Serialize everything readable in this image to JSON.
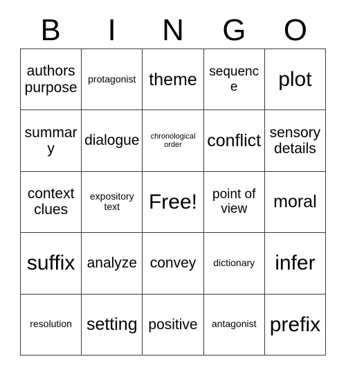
{
  "card": {
    "title_letters": [
      "B",
      "I",
      "N",
      "G",
      "O"
    ],
    "free_space_label": "Free!",
    "rows": [
      [
        {
          "text": "authors purpose",
          "size": "lg"
        },
        {
          "text": "protagonist",
          "size": "sm"
        },
        {
          "text": "theme",
          "size": "xl"
        },
        {
          "text": "sequence",
          "size": "md"
        },
        {
          "text": "plot",
          "size": "xxl"
        }
      ],
      [
        {
          "text": "summary",
          "size": "lg"
        },
        {
          "text": "dialogue",
          "size": "lg"
        },
        {
          "text": "chronological order",
          "size": "xs"
        },
        {
          "text": "conflict",
          "size": "xl"
        },
        {
          "text": "sensory details",
          "size": "lg"
        }
      ],
      [
        {
          "text": "context clues",
          "size": "lg"
        },
        {
          "text": "expository text",
          "size": "sm"
        },
        {
          "text": "Free!",
          "size": "xxl"
        },
        {
          "text": "point of view",
          "size": "md"
        },
        {
          "text": "moral",
          "size": "xl"
        }
      ],
      [
        {
          "text": "suffix",
          "size": "xxl"
        },
        {
          "text": "analyze",
          "size": "lg"
        },
        {
          "text": "convey",
          "size": "lg"
        },
        {
          "text": "dictionary",
          "size": "sm"
        },
        {
          "text": "infer",
          "size": "xxl"
        }
      ],
      [
        {
          "text": "resolution",
          "size": "sm"
        },
        {
          "text": "setting",
          "size": "xl"
        },
        {
          "text": "positive",
          "size": "lg"
        },
        {
          "text": "antagonist",
          "size": "sm"
        },
        {
          "text": "prefix",
          "size": "xxl"
        }
      ]
    ]
  },
  "colors": {
    "background": "#ffffff",
    "grid_line": "#3a3a3a",
    "text": "#000000"
  }
}
